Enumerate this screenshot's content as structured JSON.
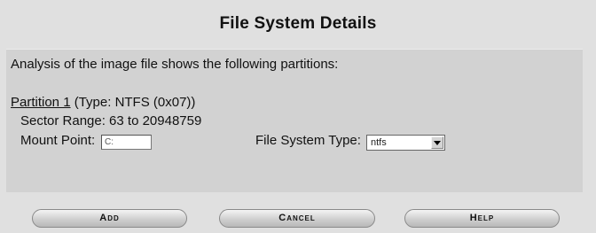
{
  "title": "File System Details",
  "intro": "Analysis of the image file shows the following partitions:",
  "partition": {
    "name": "Partition 1",
    "type_text": " (Type: NTFS (0x07))",
    "sector_range": "Sector Range: 63 to 20948759",
    "mount_label": "Mount Point:",
    "mount_value": "C:",
    "fs_type_label": "File System Type:",
    "fs_type_value": "ntfs"
  },
  "buttons": {
    "add": "Add",
    "cancel": "Cancel",
    "help": "Help"
  }
}
